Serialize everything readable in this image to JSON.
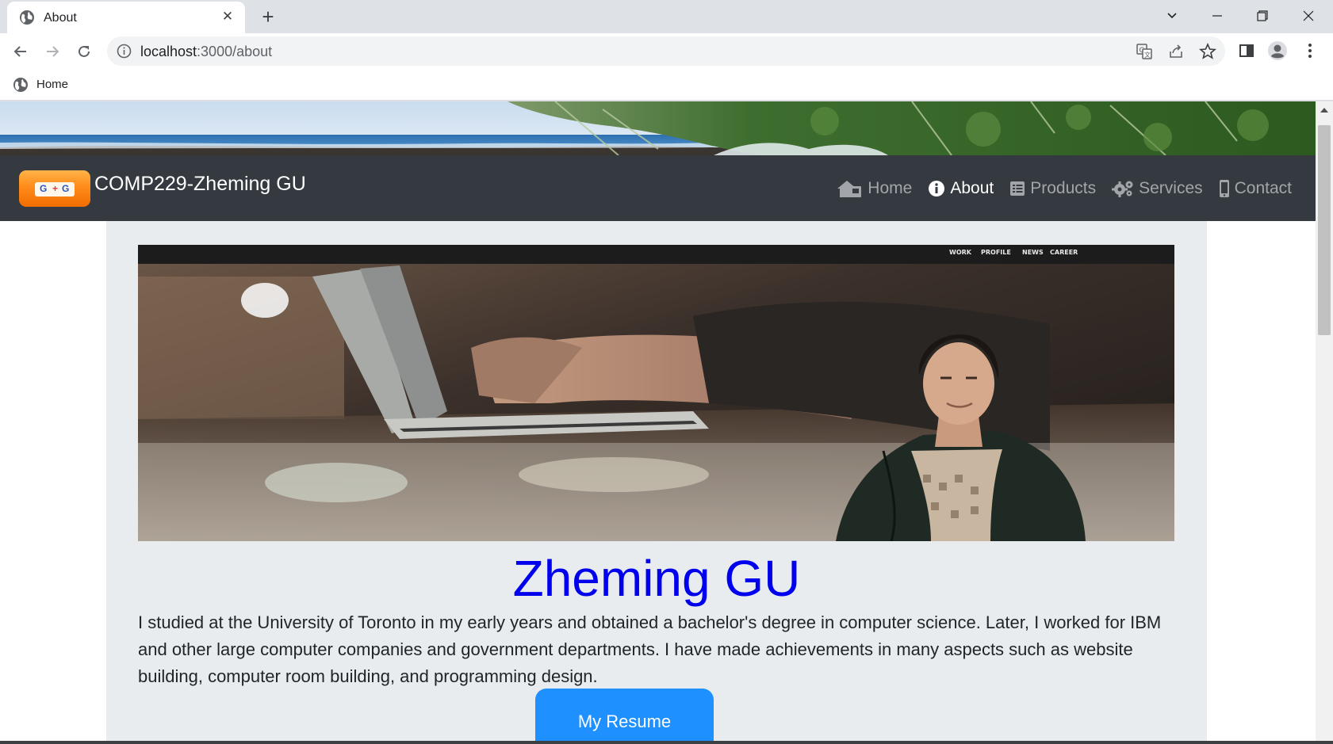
{
  "browser": {
    "tab_title": "About",
    "url_host": "localhost",
    "url_path": ":3000/about",
    "bookmark_label": "Home"
  },
  "site": {
    "brand": "COMP229-Zheming GU",
    "logo_text": [
      "G",
      "G"
    ],
    "nav": [
      {
        "label": "Home",
        "icon": "home-icon"
      },
      {
        "label": "About",
        "icon": "info-icon",
        "active": true
      },
      {
        "label": "Products",
        "icon": "products-icon"
      },
      {
        "label": "Services",
        "icon": "cogs-icon"
      },
      {
        "label": "Contact",
        "icon": "phone-icon"
      }
    ],
    "hero_menu": [
      "WORK",
      "PROFILE",
      "NEWS",
      "CAREER"
    ]
  },
  "about": {
    "name": "Zheming GU",
    "bio": "I studied at the University of Toronto in my early years and obtained a bachelor's degree in computer science. Later, I worked for IBM and other large computer companies and government departments. I have made achievements in many aspects such as website building, computer room building, and programming design.",
    "button_label": "My Resume"
  },
  "colors": {
    "navbar": "#343a40",
    "content_bg": "#e9ecef",
    "name": "#0000ee",
    "button": "#1e90ff"
  }
}
